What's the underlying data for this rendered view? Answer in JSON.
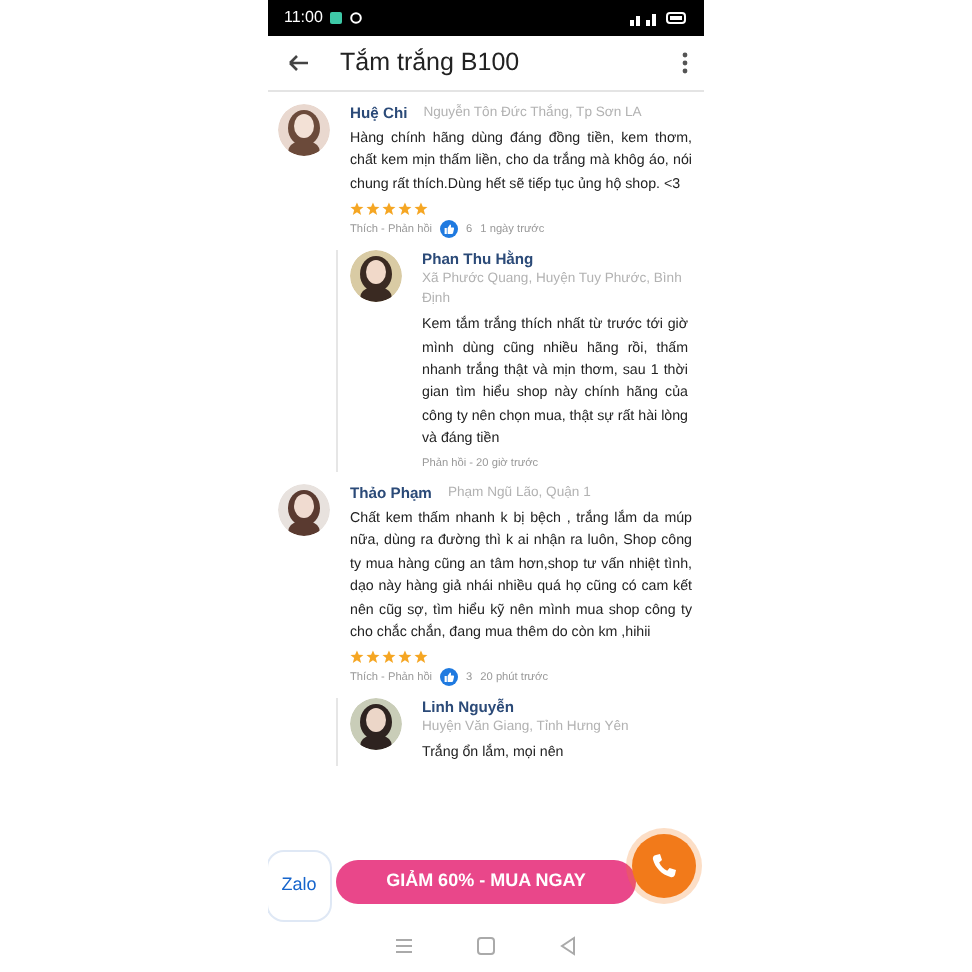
{
  "status_bar": {
    "time": "11:00"
  },
  "header": {
    "title": "Tắm trắng B100"
  },
  "comments": [
    {
      "name": "Huệ Chi",
      "location": "Nguyễn Tôn Đức Thắng, Tp Sơn LA",
      "text": "Hàng chính hãng dùng đáng đồng tiền, kem thơm, chất kem mịn thấm liền, cho da trắng mà khôg áo, nói chung rất thích.Dùng hết sẽ tiếp tục ủng hộ shop. <3",
      "stars": 5,
      "actions": "Thích - Phản hồi",
      "likes": "6",
      "time": "1 ngày trước",
      "children": [
        {
          "name": "Phan Thu Hằng",
          "location": "Xã Phước Quang, Huyện Tuy Phước, Bình Định",
          "text": "Kem tắm trắng thích nhất từ trước tới giờ mình dùng cũng nhiều hãng rồi, thấm nhanh trắng thật và mịn thơm, sau 1 thời gian tìm hiểu shop này chính hãng của công ty nên chọn mua, thật sự rất hài lòng và đáng tiền",
          "actions": "Phản hồi - 20 giờ trước"
        }
      ]
    },
    {
      "name": "Thảo Phạm",
      "location": "Phạm Ngũ Lão, Quận 1",
      "text": "Chất kem thấm nhanh k bị bệch , trắng lắm da múp nữa, dùng ra đường thì k ai nhận ra luôn, Shop công ty mua hàng cũng an tâm hơn,shop tư vấn nhiệt tình, dạo này hàng giả nhái nhiều quá họ cũng có cam kết nên cũg sợ, tìm hiểu kỹ nên mình mua shop công ty cho chắc chắn, đang mua thêm do còn km ,hihii",
      "stars": 5,
      "actions": "Thích - Phản hồi",
      "likes": "3",
      "time": "20 phút trước",
      "children": [
        {
          "name": "Linh Nguyễn",
          "location": "Huyện Văn Giang, Tỉnh Hưng Yên",
          "text": "Trắng ổn lắm, mọi nên"
        }
      ]
    }
  ],
  "chat": {
    "label": "Zalo"
  },
  "promo": {
    "label": "GIẢM 60% - MUA NGAY"
  }
}
